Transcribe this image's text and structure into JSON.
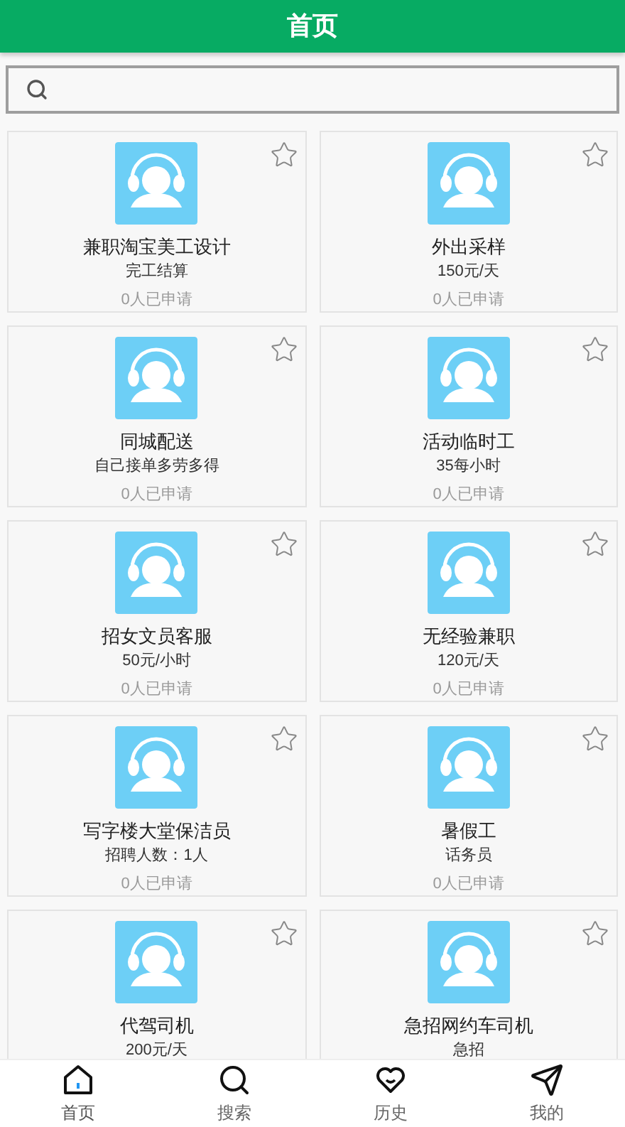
{
  "header": {
    "title": "首页"
  },
  "jobs": [
    {
      "title": "兼职淘宝美工设计",
      "subtitle": "完工结算",
      "applied": "0人已申请",
      "starred": false
    },
    {
      "title": "外出采样",
      "subtitle": "150元/天",
      "applied": "0人已申请",
      "starred": false
    },
    {
      "title": "同城配送",
      "subtitle": "自己接单多劳多得",
      "applied": "0人已申请",
      "starred": false
    },
    {
      "title": "活动临时工",
      "subtitle": "35每小时",
      "applied": "0人已申请",
      "starred": false
    },
    {
      "title": "招女文员客服",
      "subtitle": "50元/小时",
      "applied": "0人已申请",
      "starred": false
    },
    {
      "title": "无经验兼职",
      "subtitle": "120元/天",
      "applied": "0人已申请",
      "starred": false
    },
    {
      "title": "写字楼大堂保洁员",
      "subtitle": "招聘人数：1人",
      "applied": "0人已申请",
      "starred": false
    },
    {
      "title": "暑假工",
      "subtitle": "话务员",
      "applied": "0人已申请",
      "starred": false
    },
    {
      "title": "代驾司机",
      "subtitle": "200元/天",
      "starred": false
    },
    {
      "title": "急招网约车司机",
      "subtitle": "急招",
      "starred": false
    }
  ],
  "nav": [
    {
      "kind": "home",
      "label": "首页",
      "selected": true
    },
    {
      "kind": "search",
      "label": "搜索",
      "selected": false
    },
    {
      "kind": "history",
      "label": "历史",
      "selected": false
    },
    {
      "kind": "mine",
      "label": "我的",
      "selected": false
    }
  ]
}
